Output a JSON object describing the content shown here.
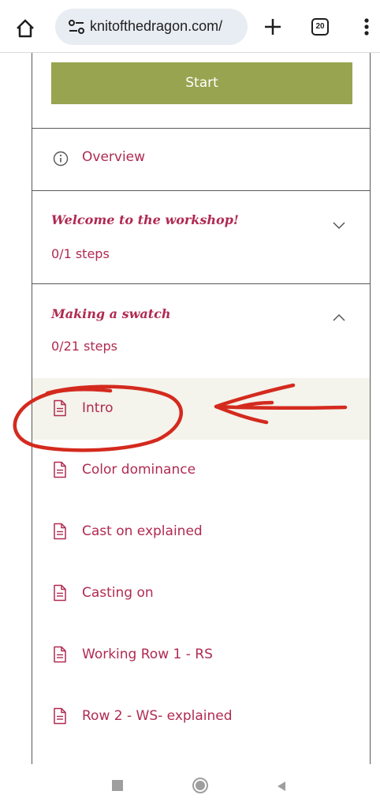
{
  "browser": {
    "url": "knitofthedragon.com/",
    "tab_count": "20"
  },
  "course": {
    "start_label": "Start",
    "overview_label": "Overview",
    "sections": [
      {
        "title": "Welcome to the workshop!",
        "steps": "0/1 steps",
        "expanded": false
      },
      {
        "title": "Making a swatch",
        "steps": "0/21 steps",
        "expanded": true
      }
    ],
    "lessons": [
      {
        "label": "Intro",
        "active": true
      },
      {
        "label": "Color dominance",
        "active": false
      },
      {
        "label": "Cast on explained",
        "active": false
      },
      {
        "label": "Casting on",
        "active": false
      },
      {
        "label": "Working Row 1 - RS",
        "active": false
      },
      {
        "label": "Row 2 - WS- explained",
        "active": false
      }
    ]
  },
  "annotation": {
    "color": "#d42a1e"
  },
  "colors": {
    "accent": "#b02a51",
    "start_button": "#98a44f",
    "active_row": "#f4f3ec"
  }
}
